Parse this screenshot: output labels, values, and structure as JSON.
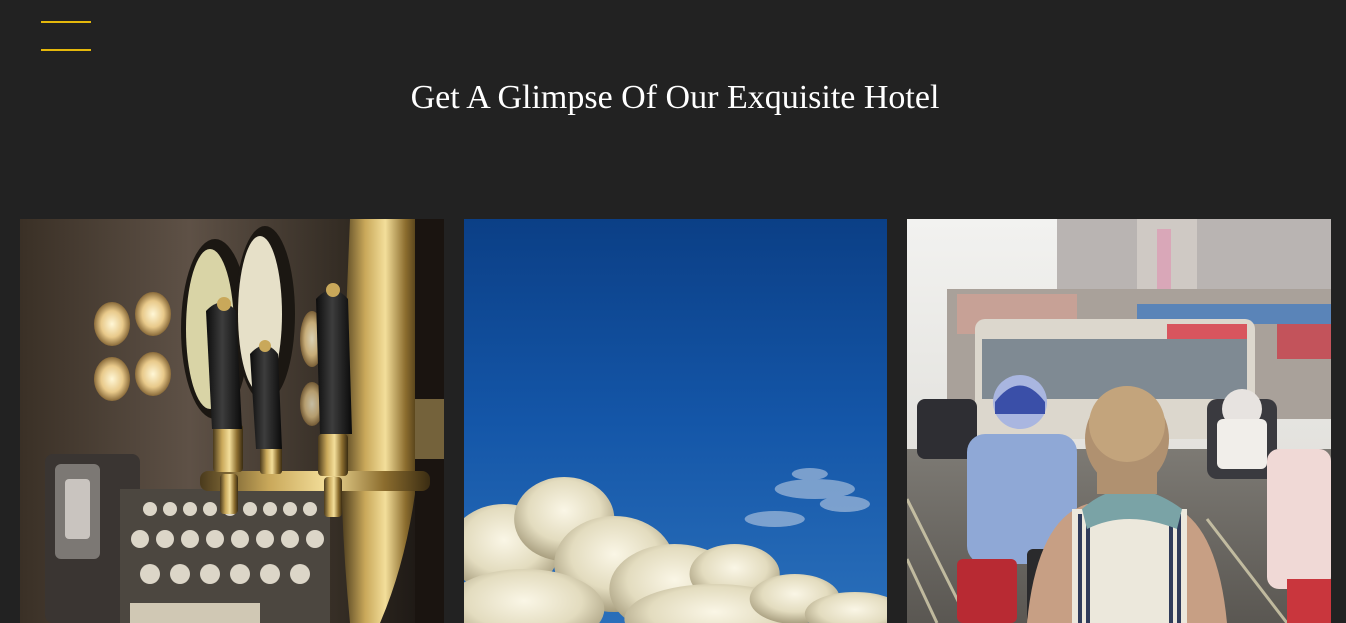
{
  "header": {
    "menu_icon": "hamburger-menu-icon",
    "accent_color": "#e5b80b"
  },
  "section": {
    "title": "Get A Glimpse Of Our Exquisite Hotel"
  },
  "gallery": {
    "items": [
      {
        "subject": "bar beer taps"
      },
      {
        "subject": "blue sky with clouds"
      },
      {
        "subject": "traveler on a busy city street"
      }
    ]
  },
  "colors": {
    "background": "#222222",
    "title": "#ffffff"
  }
}
